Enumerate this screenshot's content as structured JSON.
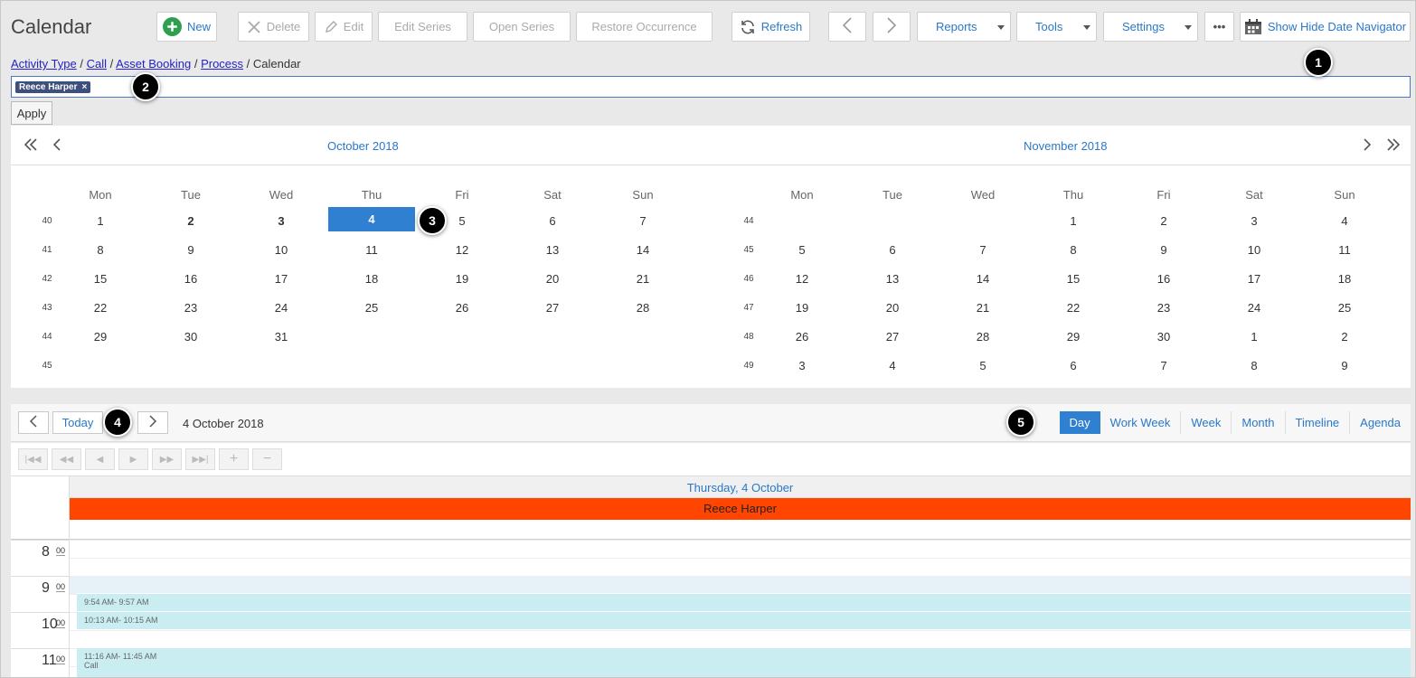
{
  "app": {
    "title": "Calendar"
  },
  "toolbar": {
    "new": "New",
    "delete": "Delete",
    "edit": "Edit",
    "edit_series": "Edit Series",
    "open_series": "Open Series",
    "restore_occurrence": "Restore Occurrence",
    "refresh": "Refresh",
    "reports": "Reports",
    "tools": "Tools",
    "settings": "Settings",
    "more": "•••",
    "show_hide_navigator": "Show Hide Date Navigator",
    "accent": "#2a78c8",
    "new_icon_color": "#2e9e4f"
  },
  "breadcrumb": {
    "items": [
      "Activity Type",
      "Call",
      "Asset Booking",
      "Process"
    ],
    "separator": " / ",
    "current": "Calendar"
  },
  "filter": {
    "chip": "Reece Harper",
    "chip_remove": "×",
    "apply": "Apply"
  },
  "badges": [
    "1",
    "2",
    "3",
    "4",
    "5"
  ],
  "navigator": {
    "left_month": {
      "title": "October 2018",
      "weekdays": [
        "Mon",
        "Tue",
        "Wed",
        "Thu",
        "Fri",
        "Sat",
        "Sun"
      ],
      "weeks": [
        {
          "wk": "40",
          "days": [
            "1",
            "2",
            "3",
            "4",
            "5",
            "6",
            "7"
          ]
        },
        {
          "wk": "41",
          "days": [
            "8",
            "9",
            "10",
            "11",
            "12",
            "13",
            "14"
          ]
        },
        {
          "wk": "42",
          "days": [
            "15",
            "16",
            "17",
            "18",
            "19",
            "20",
            "21"
          ]
        },
        {
          "wk": "43",
          "days": [
            "22",
            "23",
            "24",
            "25",
            "26",
            "27",
            "28"
          ]
        },
        {
          "wk": "44",
          "days": [
            "29",
            "30",
            "31",
            "",
            "",
            "",
            ""
          ]
        },
        {
          "wk": "45",
          "days": [
            "",
            "",
            "",
            "",
            "",
            "",
            ""
          ]
        }
      ],
      "bold_days": [
        "2",
        "3"
      ],
      "selected": "4"
    },
    "right_month": {
      "title": "November 2018",
      "weekdays": [
        "Mon",
        "Tue",
        "Wed",
        "Thu",
        "Fri",
        "Sat",
        "Sun"
      ],
      "weeks": [
        {
          "wk": "44",
          "days": [
            "",
            "",
            "",
            "1",
            "2",
            "3",
            "4"
          ]
        },
        {
          "wk": "45",
          "days": [
            "5",
            "6",
            "7",
            "8",
            "9",
            "10",
            "11"
          ]
        },
        {
          "wk": "46",
          "days": [
            "12",
            "13",
            "14",
            "15",
            "16",
            "17",
            "18"
          ]
        },
        {
          "wk": "47",
          "days": [
            "19",
            "20",
            "21",
            "22",
            "23",
            "24",
            "25"
          ]
        },
        {
          "wk": "48",
          "days": [
            "26",
            "27",
            "28",
            "29",
            "30",
            "1",
            "2"
          ]
        },
        {
          "wk": "49",
          "days": [
            "3",
            "4",
            "5",
            "6",
            "7",
            "8",
            "9"
          ]
        }
      ]
    },
    "selected_color": "#2f80d1"
  },
  "scheduler": {
    "today": "Today",
    "current_date": "4 October 2018",
    "views": [
      "Day",
      "Work Week",
      "Week",
      "Month",
      "Timeline",
      "Agenda"
    ],
    "active_view": "Day",
    "day_header": "Thursday, 4 October",
    "resource": "Reece Harper",
    "resource_color": "#ff4500",
    "hours": [
      {
        "h": "8",
        "m": "00"
      },
      {
        "h": "9",
        "m": "00"
      },
      {
        "h": "10",
        "m": "00"
      },
      {
        "h": "11",
        "m": "00"
      }
    ],
    "appointments": [
      {
        "time": "9:54 AM-  9:57 AM",
        "subject": ""
      },
      {
        "time": "10:13 AM-  10:15 AM",
        "subject": ""
      },
      {
        "time": "11:16 AM-  11:45 AM",
        "subject": "Call"
      }
    ],
    "appointment_color": "#c9edf1"
  }
}
